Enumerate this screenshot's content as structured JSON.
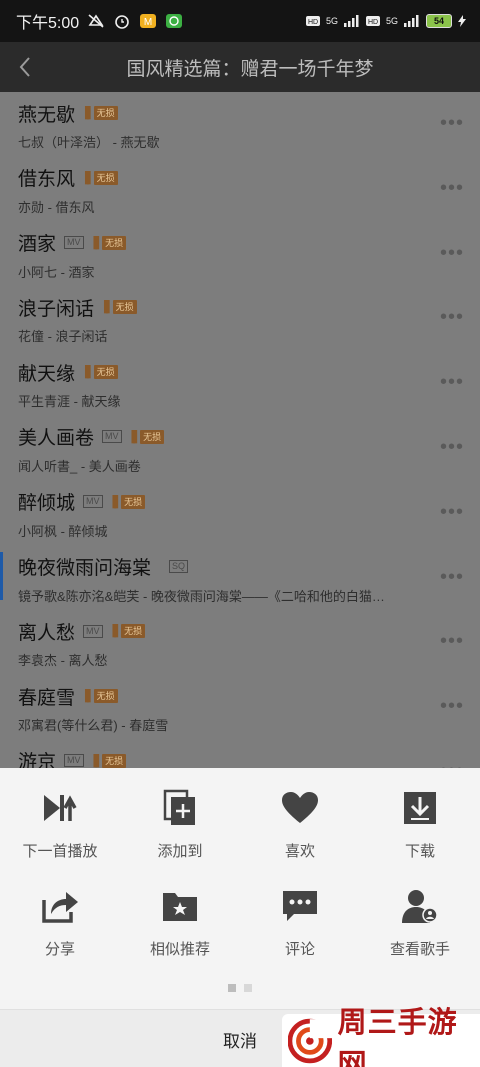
{
  "status": {
    "time": "下午5:00",
    "net1": "5G",
    "net2": "5G",
    "battery": "54"
  },
  "header": {
    "title": "国风精选篇：赠君一场千年梦"
  },
  "tags": {
    "mv": "MV",
    "sq": "SQ",
    "vip": "无损"
  },
  "songs": [
    {
      "name": "燕无歇",
      "sub": "七叔（叶泽浩） - 燕无歇"
    },
    {
      "name": "借东风",
      "sub": "亦勋 - 借东风"
    },
    {
      "name": "酒家",
      "sub": "小阿七 - 酒家"
    },
    {
      "name": "浪子闲话",
      "sub": "花僮 - 浪子闲话"
    },
    {
      "name": "献天缘",
      "sub": "平生青涯 - 献天缘"
    },
    {
      "name": "美人画卷",
      "sub": "闻人听書_ - 美人画卷"
    },
    {
      "name": "醉倾城",
      "sub": "小阿枫 - 醉倾城"
    },
    {
      "name": "晚夜微雨问海棠",
      "sub": "镜予歌&陈亦洺&皑芙 - 晚夜微雨问海棠——《二哈和他的白猫…"
    },
    {
      "name": "离人愁",
      "sub": "李袁杰 - 离人愁"
    },
    {
      "name": "春庭雪",
      "sub": "邓寓君(等什么君) - 春庭雪"
    },
    {
      "name": "游京",
      "sub": ""
    }
  ],
  "sheet": {
    "actions": [
      {
        "label": "下一首播放",
        "icon": "play-next-icon"
      },
      {
        "label": "添加到",
        "icon": "add-to-icon"
      },
      {
        "label": "喜欢",
        "icon": "heart-icon"
      },
      {
        "label": "下载",
        "icon": "download-icon"
      },
      {
        "label": "分享",
        "icon": "share-icon"
      },
      {
        "label": "相似推荐",
        "icon": "similar-folder-icon"
      },
      {
        "label": "评论",
        "icon": "comment-icon"
      },
      {
        "label": "查看歌手",
        "icon": "singer-icon"
      }
    ],
    "cancel": "取消",
    "watermark": "周三手游网"
  }
}
